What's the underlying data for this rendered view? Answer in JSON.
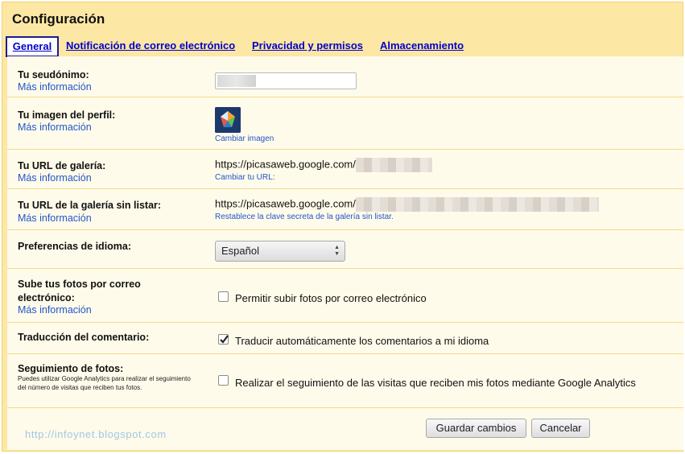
{
  "page": {
    "title": "Configuración"
  },
  "tabs": [
    {
      "label": "General",
      "active": true
    },
    {
      "label": "Notificación de correo electrónico"
    },
    {
      "label": "Privacidad y permisos"
    },
    {
      "label": "Almacenamiento"
    }
  ],
  "more_info": "Más información",
  "rows": {
    "nickname": {
      "label": "Tu seudónimo:"
    },
    "avatar": {
      "label": "Tu imagen del perfil:",
      "link": "Cambiar imagen"
    },
    "gallery_url": {
      "label": "Tu URL de galería:",
      "value": "https://picasaweb.google.com/",
      "link": "Cambiar tu URL:"
    },
    "unlisted_url": {
      "label": "Tu URL de la galería sin listar:",
      "value": "https://picasaweb.google.com/",
      "link": "Restablece la clave secreta de la galería sin listar."
    },
    "language": {
      "label": "Preferencias de idioma:",
      "selected": "Español"
    },
    "email_upload": {
      "label": "Sube tus fotos por correo electrónico:",
      "checkbox": "Permitir subir fotos por correo electrónico",
      "checked": false
    },
    "translation": {
      "label": "Traducción del comentario:",
      "checkbox": "Traducir automáticamente los comentarios a mi idioma",
      "checked": true
    },
    "tracking": {
      "label": "Seguimiento de fotos:",
      "description": "Puedes utilizar Google Analytics para realizar el seguimiento del número de visitas que reciben tus fotos.",
      "checkbox": "Realizar el seguimiento de las visitas que reciben mis fotos mediante Google Analytics",
      "checked": false
    }
  },
  "buttons": {
    "save": "Guardar cambios",
    "cancel": "Cancelar"
  },
  "watermark": "http://infoynet.blogspot.com",
  "colors": {
    "frame": "#fde7a4",
    "panel": "#fffbea",
    "link": "#2255cc",
    "tab_link": "#0000cc"
  }
}
